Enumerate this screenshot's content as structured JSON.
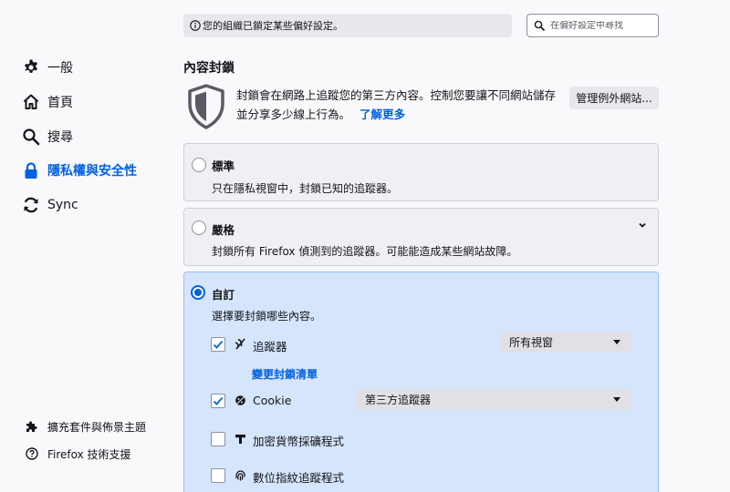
{
  "sidebar": {
    "items": [
      {
        "label": "一般",
        "icon": "gear-icon"
      },
      {
        "label": "首頁",
        "icon": "home-icon"
      },
      {
        "label": "搜尋",
        "icon": "search-icon"
      },
      {
        "label": "隱私權與安全性",
        "icon": "lock-icon",
        "active": true
      },
      {
        "label": "Sync",
        "icon": "sync-icon"
      }
    ],
    "footer": [
      {
        "label": "擴充套件與佈景主題",
        "icon": "puzzle-icon"
      },
      {
        "label": "Firefox 技術支援",
        "icon": "help-icon"
      }
    ]
  },
  "topbar": {
    "org_notice": "您的組織已鎖定某些偏好設定。",
    "search_placeholder": "在偏好設定中尋找"
  },
  "content_blocking": {
    "title": "內容封鎖",
    "description": "封鎖會在網路上追蹤您的第三方內容。控制您要讓不同網站儲存並分享多少線上行為。",
    "learn_more": "了解更多",
    "manage_exceptions": "管理例外網站...",
    "options": {
      "standard": {
        "title": "標準",
        "desc": "只在隱私視窗中，封鎖已知的追蹤器。"
      },
      "strict": {
        "title": "嚴格",
        "desc": "封鎖所有 Firefox 偵測到的追蹤器。可能能造成某些網站故障。"
      },
      "custom": {
        "title": "自訂",
        "desc": "選擇要封鎖哪些內容。",
        "trackers": {
          "label": "追蹤器",
          "checked": true,
          "select": "所有視窗",
          "change_list": "變更封鎖清單"
        },
        "cookie": {
          "label": "Cookie",
          "checked": true,
          "select": "第三方追蹤器"
        },
        "cryptominers": {
          "label": "加密貨幣採礦程式",
          "checked": false
        },
        "fingerprinters": {
          "label": "數位指紋追蹤程式",
          "checked": false
        }
      }
    },
    "selected_option": "custom"
  },
  "colors": {
    "accent": "#0061e0",
    "selected_card": "#d5e6fc"
  }
}
